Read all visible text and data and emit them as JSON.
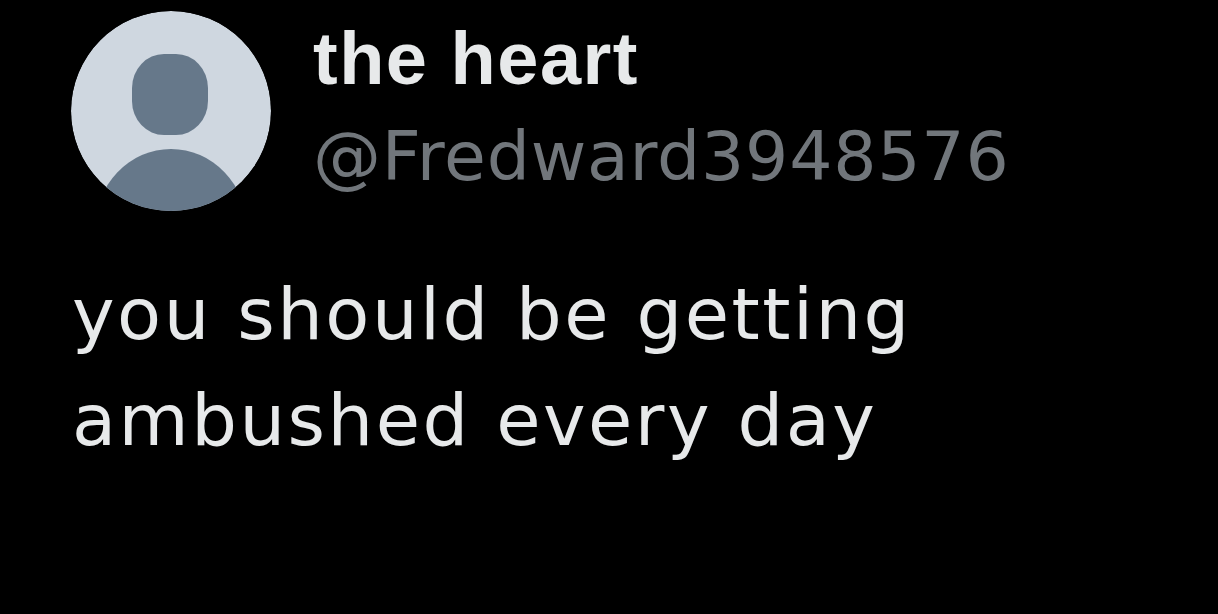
{
  "author": {
    "display_name": "the heart",
    "handle": "@Fredward3948576"
  },
  "tweet": {
    "text": "you should be getting ambushed every day"
  }
}
